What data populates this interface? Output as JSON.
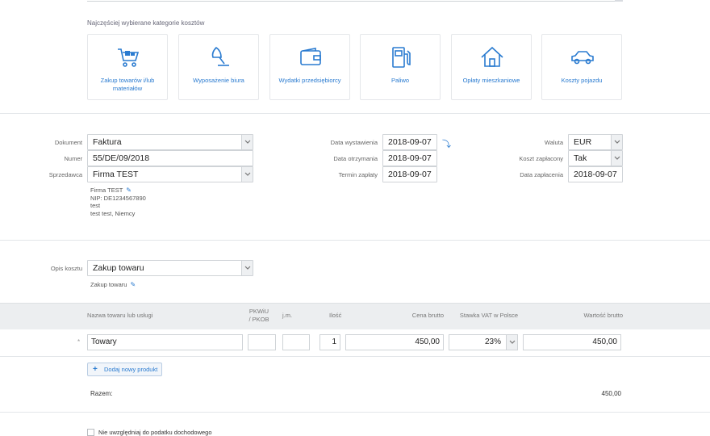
{
  "categories_title": "Najczęściej wybierane kategorie kosztów",
  "categories": [
    {
      "label": "Zakup towarów i/lub materiałów",
      "icon": "shopping-cart-icon"
    },
    {
      "label": "Wyposażenie biura",
      "icon": "desk-lamp-icon"
    },
    {
      "label": "Wydatki przedsiębiorcy",
      "icon": "wallet-icon"
    },
    {
      "label": "Paliwo",
      "icon": "fuel-pump-icon"
    },
    {
      "label": "Opłaty mieszkaniowe",
      "icon": "house-icon"
    },
    {
      "label": "Koszty pojazdu",
      "icon": "car-icon"
    }
  ],
  "document": {
    "doc_label": "Dokument",
    "doc_value": "Faktura",
    "num_label": "Numer",
    "num_value": "55/DE/09/2018",
    "seller_label": "Sprzedawca",
    "seller_value": "Firma TEST",
    "seller_details": [
      "Firma TEST",
      "NIP: DE1234567890",
      "test",
      "test test, Niemcy"
    ]
  },
  "dates": {
    "issue_label": "Data wystawienia",
    "issue_value": "2018-09-07",
    "received_label": "Data otrzymania",
    "received_value": "2018-09-07",
    "due_label": "Termin zapłaty",
    "due_value": "2018-09-07"
  },
  "payment": {
    "currency_label": "Waluta",
    "currency_value": "EUR",
    "paid_label": "Koszt zapłacony",
    "paid_value": "Tak",
    "paid_date_label": "Data zapłacenia",
    "paid_date_value": "2018-09-07"
  },
  "cost_desc": {
    "label": "Opis kosztu",
    "value": "Zakup towaru",
    "sub": "Zakup towaru"
  },
  "table": {
    "headers": {
      "name": "Nazwa towaru lub usługi",
      "pkwiu": "PKWiU\n/ PKOB",
      "unit": "j.m.",
      "qty": "Ilość",
      "price": "Cena brutto",
      "vat": "Stawka VAT w Polsce",
      "total": "Wartość brutto"
    },
    "row": {
      "marker": "*",
      "name": "Towary",
      "pkwiu": "",
      "unit": "",
      "qty": "1",
      "price": "450,00",
      "vat": "23%",
      "total": "450,00"
    },
    "add_button": "Dodaj nowy produkt",
    "sum_label": "Razem:",
    "sum_value": "450,00"
  },
  "checkbox_label": "Nie uwzględniaj do podatku dochodowego",
  "colors": {
    "accent": "#2a7bd0",
    "border": "#cfd3d7",
    "header_bg": "#eceef0"
  }
}
